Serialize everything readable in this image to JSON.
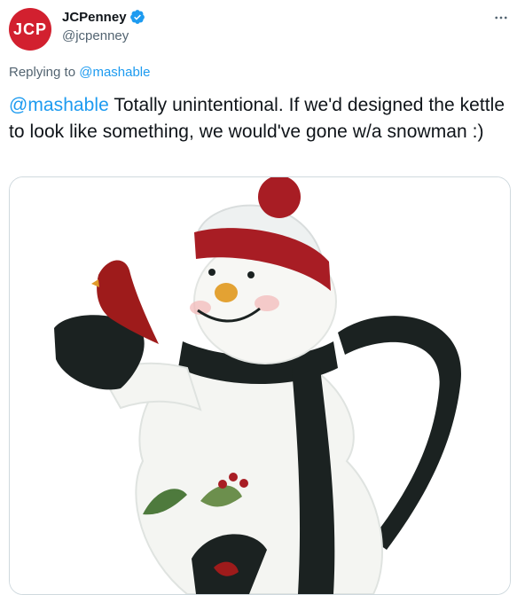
{
  "account": {
    "avatar_text": "JCP",
    "display_name": "JCPenney",
    "handle": "@jcpenney",
    "verified": true
  },
  "reply": {
    "prefix": "Replying to",
    "mention": "@mashable"
  },
  "tweet": {
    "mention": "@mashable",
    "text": " Totally unintentional. If we'd designed the kettle to look like something, we would've gone w/a snowman :)"
  },
  "media": {
    "icon": "snowman-kettle-image"
  },
  "colors": {
    "brand_red": "#d2202f",
    "link_blue": "#1d9bf0",
    "secondary_text": "#536471",
    "border": "#cfd9de"
  }
}
